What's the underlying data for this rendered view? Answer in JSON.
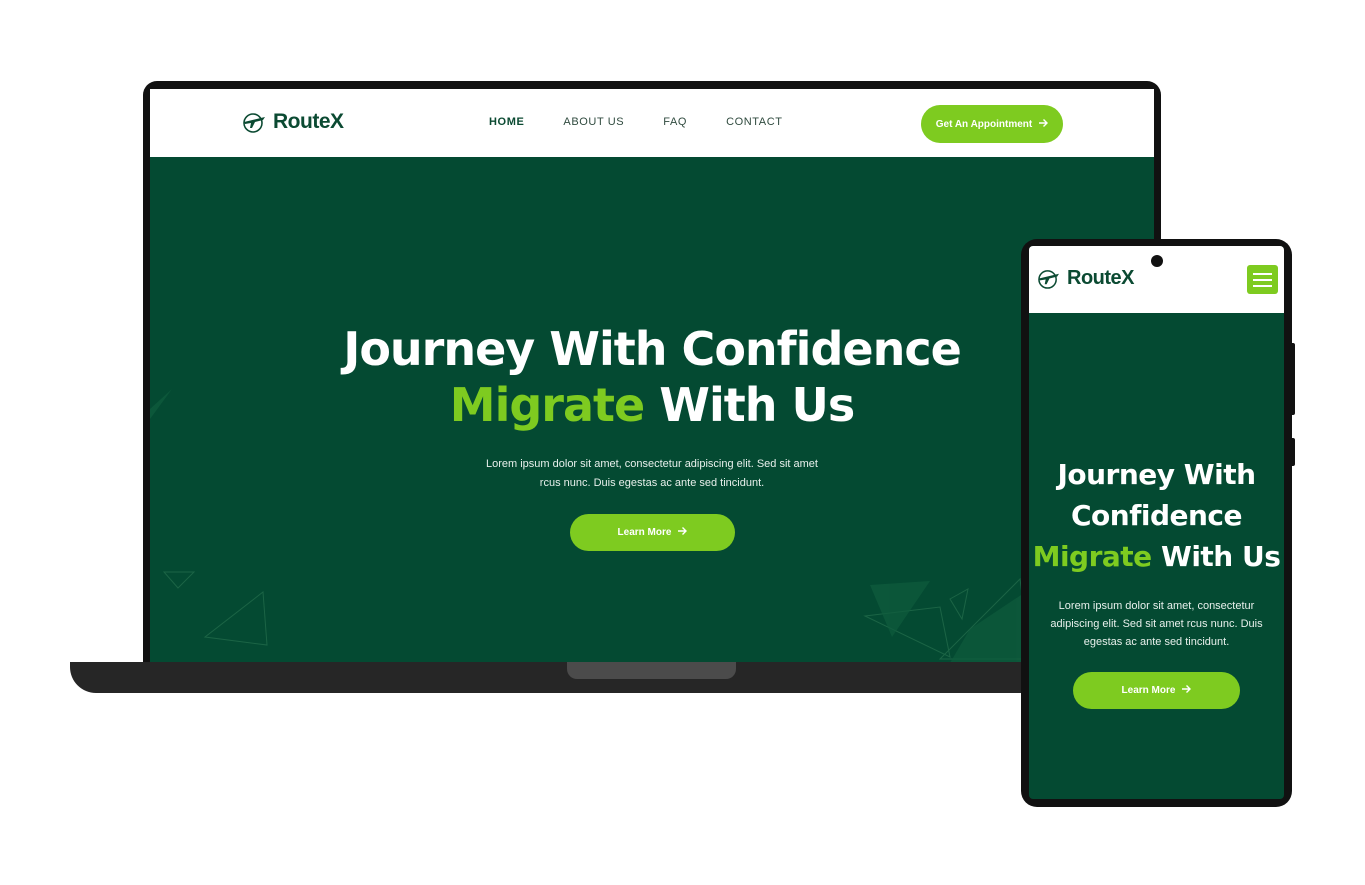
{
  "brand": {
    "name": "RouteX",
    "logo_icon": "airplane-globe-icon"
  },
  "colors": {
    "primary_dark": "#044a32",
    "accent": "#7ecb20",
    "text_dark": "#0b4a32"
  },
  "desktop": {
    "nav": [
      "HOME",
      "ABOUT US",
      "FAQ",
      "CONTACT"
    ],
    "active_nav": "HOME",
    "cta_label": "Get An Appointment",
    "hero": {
      "title_line1": "Journey With Confidence",
      "title_line2_highlight": "Migrate",
      "title_line2_rest": "With Us",
      "description": "Lorem ipsum dolor sit amet, consectetur adipiscing elit. Sed sit amet rcus nunc. Duis egestas ac ante sed tincidunt.",
      "button_label": "Learn More"
    }
  },
  "mobile": {
    "menu_icon": "hamburger-menu-icon",
    "hero": {
      "title_line1": "Journey With",
      "title_line2": "Confidence",
      "title_line3_highlight": "Migrate",
      "title_line3_rest": "With Us",
      "description": "Lorem ipsum dolor sit amet, consectetur adipiscing elit. Sed sit amet rcus nunc. Duis egestas ac ante sed tincidunt.",
      "button_label": "Learn More"
    }
  }
}
